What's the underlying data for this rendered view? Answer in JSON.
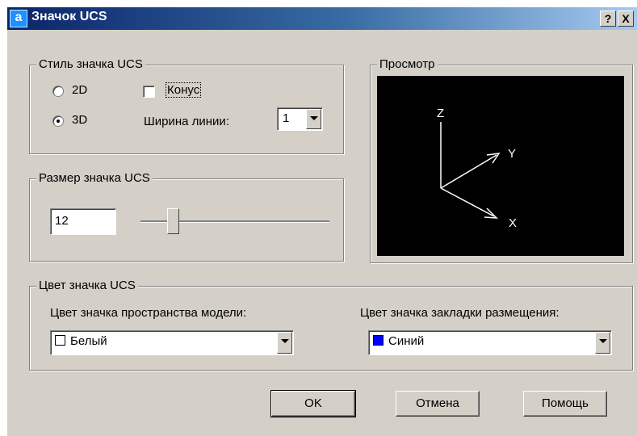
{
  "window": {
    "title": "Значок UCS",
    "app_icon_glyph": "a",
    "help_label": "?",
    "close_label": "X"
  },
  "style_group": {
    "legend": "Стиль значка UCS",
    "radio_2d": "2D",
    "radio_3d": "3D",
    "selected": "3D",
    "cone_label": "Конус",
    "cone_checked": false,
    "line_width_label": "Ширина линии:",
    "line_width_value": "1"
  },
  "preview_group": {
    "legend": "Просмотр",
    "axis_z": "Z",
    "axis_y": "Y",
    "axis_x": "X",
    "background": "#000000",
    "axis_color": "#ffffff"
  },
  "size_group": {
    "legend": "Размер значка UCS",
    "value": "12",
    "slider_fraction": 0.15
  },
  "color_group": {
    "legend": "Цвет значка UCS",
    "model_label": "Цвет значка пространства модели:",
    "model_value": "Белый",
    "model_swatch": "#ffffff",
    "layout_label": "Цвет значка закладки размещения:",
    "layout_value": "Синий",
    "layout_swatch": "#0000ff"
  },
  "buttons": {
    "ok": "OK",
    "cancel": "Отмена",
    "help": "Помощь"
  }
}
